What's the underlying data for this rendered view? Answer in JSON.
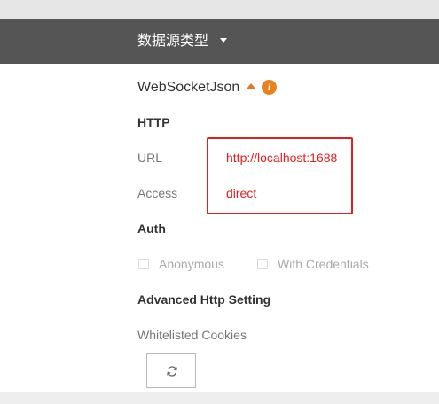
{
  "header": {
    "title": "数据源类型"
  },
  "datasource": {
    "name": "WebSocketJson",
    "info_icon": "info-icon",
    "collapse_icon": "caret-up-icon"
  },
  "http": {
    "heading": "HTTP",
    "url_label": "URL",
    "url_value": "http://localhost:1688",
    "access_label": "Access",
    "access_value": "direct"
  },
  "auth": {
    "heading": "Auth",
    "anonymous_label": "Anonymous",
    "credentials_label": "With Credentials"
  },
  "advanced": {
    "heading": "Advanced Http Setting",
    "cookies_label": "Whitelisted Cookies",
    "refresh_icon": "refresh-icon"
  },
  "colors": {
    "header_bg": "#555555",
    "highlight": "#e02020",
    "accent": "#e8821e"
  }
}
